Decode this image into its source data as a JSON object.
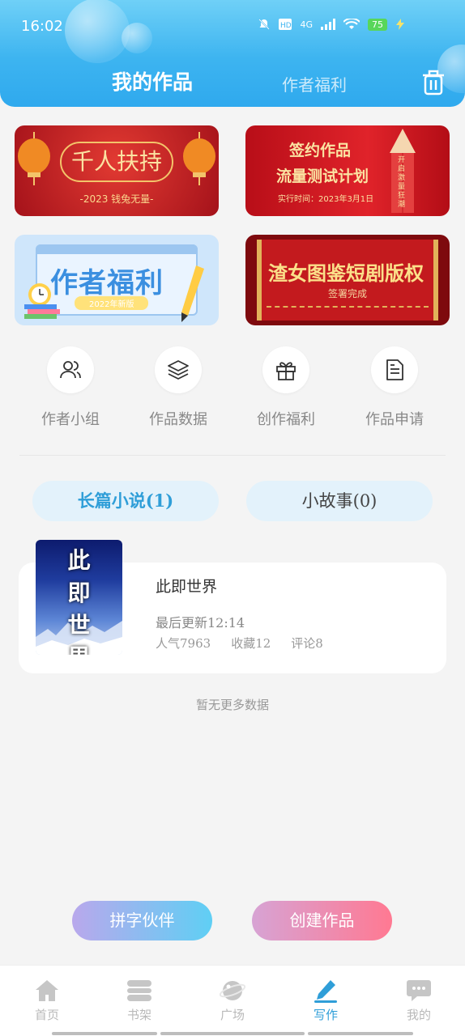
{
  "status_bar": {
    "time": "16:02",
    "network": "4G",
    "battery": "75"
  },
  "header": {
    "tab_active": "我的作品",
    "tab_other": "作者福利"
  },
  "banners": [
    {
      "title": "千人扶持",
      "subtitle": "-2023 钱兔无量-"
    },
    {
      "line1": "签约作品",
      "line2": "流量测试计划",
      "line3": "实行时间：2023年3月1日",
      "tag": "开启激量狂潮"
    },
    {
      "title": "作者福利",
      "badge": "2022年新版"
    },
    {
      "title": "渣女图鉴短剧版权",
      "subtitle": "签署完成"
    }
  ],
  "quick_actions": [
    {
      "label": "作者小组",
      "icon": "users-icon"
    },
    {
      "label": "作品数据",
      "icon": "layers-icon"
    },
    {
      "label": "创作福利",
      "icon": "gift-icon"
    },
    {
      "label": "作品申请",
      "icon": "document-icon"
    }
  ],
  "segments": {
    "long_novel": "长篇小说(1)",
    "short_story": "小故事(0)"
  },
  "book": {
    "cover_text": [
      "此",
      "即",
      "世",
      "界"
    ],
    "title": "此即世界",
    "last_update": "最后更新12:14",
    "popularity": "人气7963",
    "favorites": "收藏12",
    "comments": "评论8"
  },
  "no_more": "暂无更多数据",
  "buttons": {
    "partner": "拼字伙伴",
    "create": "创建作品"
  },
  "nav": [
    {
      "label": "首页",
      "icon": "home-icon"
    },
    {
      "label": "书架",
      "icon": "bookshelf-icon"
    },
    {
      "label": "广场",
      "icon": "planet-icon"
    },
    {
      "label": "写作",
      "icon": "pen-icon",
      "active": true
    },
    {
      "label": "我的",
      "icon": "chat-bubble-icon"
    }
  ],
  "colors": {
    "accent": "#2f9ed8",
    "header": "#3db4f0",
    "banner_red": "#c8161e"
  }
}
